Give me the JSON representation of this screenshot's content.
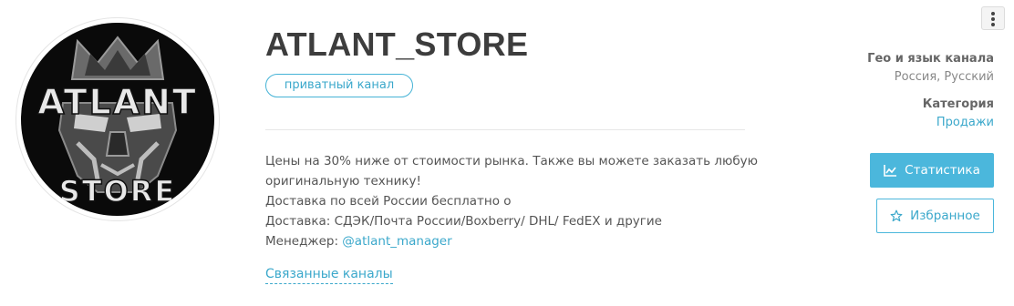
{
  "channel": {
    "avatar": {
      "logo_line1": "ATLANT",
      "logo_line2": "STORE"
    },
    "title": "ATLANT_STORE",
    "badge": "приватный канал",
    "description": {
      "line1": "Цены на 30% ниже от стоимости рынка. Также вы можете заказать любую",
      "line2": "оригинальную технику!",
      "line3": "Доставка по всей России бесплатно о",
      "line4": "Доставка: СДЭК/Почта России/Boxberry/ DHL/ FedEX и другие",
      "manager_label": "Менеджер: ",
      "manager_handle": "@atlant_manager"
    },
    "related_link": "Связанные каналы"
  },
  "sidebar": {
    "geo_label": "Гео и язык канала",
    "geo_value": "Россия, Русский",
    "category_label": "Категория",
    "category_value": "Продажи",
    "stats_button": "Статистика",
    "favorite_button": "Избранное"
  },
  "icons": {
    "menu": "more-vertical-icon",
    "stats": "line-chart-icon",
    "favorite": "star-icon"
  },
  "colors": {
    "accent": "#4bb7dc",
    "title": "#3d3d3d",
    "text": "#555555",
    "avatar_bg": "#0a0a0a"
  }
}
